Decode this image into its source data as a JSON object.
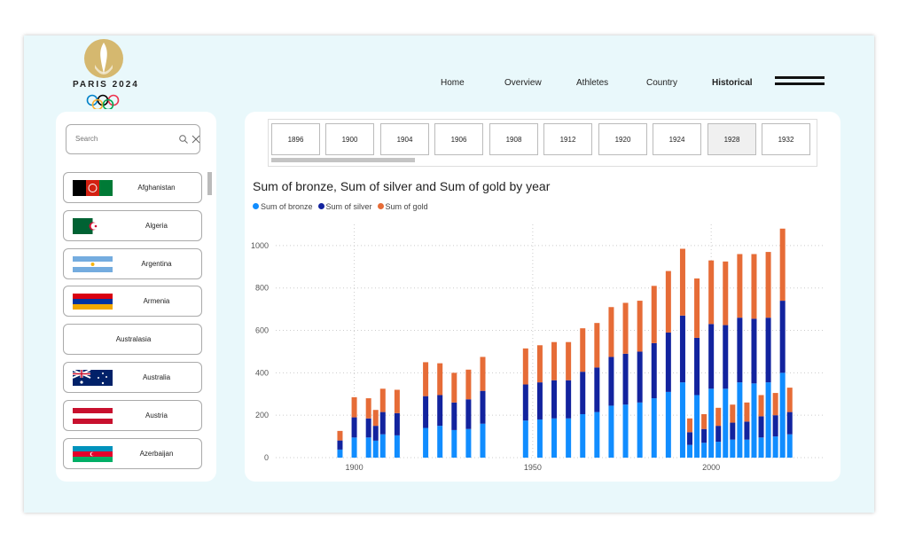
{
  "brand": {
    "logo_text": "PARIS 2024"
  },
  "nav": {
    "items": [
      {
        "label": "Home"
      },
      {
        "label": "Overview"
      },
      {
        "label": "Athletes"
      },
      {
        "label": "Country"
      },
      {
        "label": "Historical"
      }
    ],
    "active": "Historical"
  },
  "search": {
    "placeholder": "Search"
  },
  "countries": [
    {
      "name": "Afghanistan"
    },
    {
      "name": "Algeria"
    },
    {
      "name": "Argentina"
    },
    {
      "name": "Armenia"
    },
    {
      "name": "Australasia"
    },
    {
      "name": "Australia"
    },
    {
      "name": "Austria"
    },
    {
      "name": "Azerbaijan"
    }
  ],
  "years": [
    "1896",
    "1900",
    "1904",
    "1906",
    "1908",
    "1912",
    "1920",
    "1924",
    "1928",
    "1932"
  ],
  "selected_year": "1928",
  "chart_data": {
    "type": "bar",
    "stacked": true,
    "title": "Sum of bronze, Sum of silver and Sum of gold by year",
    "xlabel": "",
    "ylabel": "",
    "ylim": [
      0,
      1100
    ],
    "xlim": [
      1878,
      2032
    ],
    "xticks": [
      1900,
      1950,
      2000
    ],
    "yticks": [
      0,
      200,
      400,
      600,
      800,
      1000
    ],
    "grid": true,
    "legend_position": "top-left",
    "colors": {
      "bronze": "#118dff",
      "silver": "#12239e",
      "gold": "#e66c37"
    },
    "series": [
      {
        "name": "Sum of bronze",
        "key": "bronze"
      },
      {
        "name": "Sum of silver",
        "key": "silver"
      },
      {
        "name": "Sum of gold",
        "key": "gold"
      }
    ],
    "points": [
      {
        "year": 1896,
        "bronze": 38,
        "silver": 43,
        "gold": 45
      },
      {
        "year": 1900,
        "bronze": 95,
        "silver": 95,
        "gold": 95
      },
      {
        "year": 1904,
        "bronze": 95,
        "silver": 90,
        "gold": 95
      },
      {
        "year": 1906,
        "bronze": 80,
        "silver": 70,
        "gold": 75
      },
      {
        "year": 1908,
        "bronze": 110,
        "silver": 105,
        "gold": 110
      },
      {
        "year": 1912,
        "bronze": 105,
        "silver": 105,
        "gold": 110
      },
      {
        "year": 1920,
        "bronze": 140,
        "silver": 150,
        "gold": 160
      },
      {
        "year": 1924,
        "bronze": 150,
        "silver": 145,
        "gold": 150
      },
      {
        "year": 1928,
        "bronze": 130,
        "silver": 130,
        "gold": 140
      },
      {
        "year": 1932,
        "bronze": 135,
        "silver": 140,
        "gold": 140
      },
      {
        "year": 1936,
        "bronze": 160,
        "silver": 155,
        "gold": 160
      },
      {
        "year": 1948,
        "bronze": 175,
        "silver": 170,
        "gold": 170
      },
      {
        "year": 1952,
        "bronze": 180,
        "silver": 175,
        "gold": 175
      },
      {
        "year": 1956,
        "bronze": 185,
        "silver": 180,
        "gold": 180
      },
      {
        "year": 1960,
        "bronze": 185,
        "silver": 180,
        "gold": 180
      },
      {
        "year": 1964,
        "bronze": 205,
        "silver": 200,
        "gold": 205
      },
      {
        "year": 1968,
        "bronze": 215,
        "silver": 210,
        "gold": 210
      },
      {
        "year": 1972,
        "bronze": 245,
        "silver": 230,
        "gold": 235
      },
      {
        "year": 1976,
        "bronze": 250,
        "silver": 240,
        "gold": 240
      },
      {
        "year": 1980,
        "bronze": 260,
        "silver": 240,
        "gold": 240
      },
      {
        "year": 1984,
        "bronze": 280,
        "silver": 260,
        "gold": 270
      },
      {
        "year": 1988,
        "bronze": 310,
        "silver": 280,
        "gold": 290
      },
      {
        "year": 1992,
        "bronze": 355,
        "silver": 315,
        "gold": 315
      },
      {
        "year": 1994,
        "bronze": 60,
        "silver": 60,
        "gold": 65
      },
      {
        "year": 1996,
        "bronze": 295,
        "silver": 270,
        "gold": 280
      },
      {
        "year": 1998,
        "bronze": 70,
        "silver": 65,
        "gold": 70
      },
      {
        "year": 2000,
        "bronze": 325,
        "silver": 305,
        "gold": 300
      },
      {
        "year": 2002,
        "bronze": 75,
        "silver": 75,
        "gold": 85
      },
      {
        "year": 2004,
        "bronze": 325,
        "silver": 300,
        "gold": 300
      },
      {
        "year": 2006,
        "bronze": 85,
        "silver": 80,
        "gold": 85
      },
      {
        "year": 2008,
        "bronze": 355,
        "silver": 305,
        "gold": 300
      },
      {
        "year": 2010,
        "bronze": 85,
        "silver": 85,
        "gold": 90
      },
      {
        "year": 2012,
        "bronze": 350,
        "silver": 305,
        "gold": 305
      },
      {
        "year": 2014,
        "bronze": 95,
        "silver": 100,
        "gold": 100
      },
      {
        "year": 2016,
        "bronze": 355,
        "silver": 305,
        "gold": 310
      },
      {
        "year": 2018,
        "bronze": 100,
        "silver": 100,
        "gold": 105
      },
      {
        "year": 2020,
        "bronze": 400,
        "silver": 340,
        "gold": 340
      },
      {
        "year": 2022,
        "bronze": 110,
        "silver": 105,
        "gold": 115
      }
    ]
  }
}
